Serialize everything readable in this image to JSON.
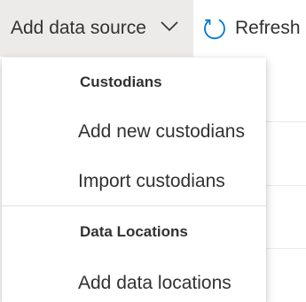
{
  "toolbar": {
    "add_data_source_label": "Add data source",
    "chevron_icon": "chevron-down-icon",
    "refresh_label": "Refresh",
    "refresh_icon": "refresh-icon",
    "accent_color": "#0078d4"
  },
  "menu": {
    "sections": [
      {
        "header": "Custodians",
        "items": [
          {
            "label": "Add new custodians"
          },
          {
            "label": "Import custodians"
          }
        ]
      },
      {
        "header": "Data Locations",
        "items": [
          {
            "label": "Add data locations"
          }
        ]
      }
    ]
  }
}
